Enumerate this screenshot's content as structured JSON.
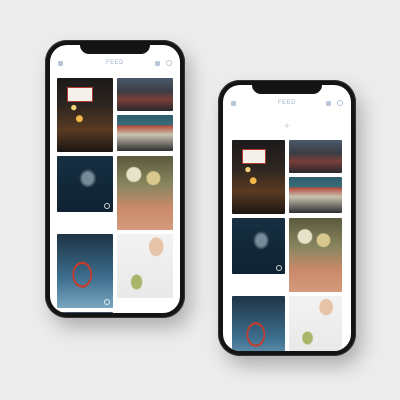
{
  "left_phone": {
    "header": {
      "title": "FEED",
      "left_icon": "camera-icon",
      "right_icons": [
        "notification-icon",
        "search-icon"
      ]
    },
    "photos": [
      {
        "name": "night-market-sign",
        "style": "night"
      },
      {
        "name": "street-scene",
        "style": "street"
      },
      {
        "name": "smoke-lamp",
        "style": "smoke"
      },
      {
        "name": "storefront",
        "style": "shop"
      },
      {
        "name": "basketball-hoop",
        "style": "hoop"
      },
      {
        "name": "incense-flowers",
        "style": "flowers"
      },
      {
        "name": "partial-photo-left",
        "style": "partial"
      },
      {
        "name": "hand-with-plant",
        "style": "hand"
      }
    ]
  },
  "right_phone": {
    "header": {
      "title": "FEED",
      "left_icon": "camera-icon",
      "right_icons": [
        "notification-icon",
        "search-icon"
      ]
    },
    "add_icon": "+",
    "photos": [
      {
        "name": "night-market-sign",
        "style": "night"
      },
      {
        "name": "street-scene",
        "style": "street"
      },
      {
        "name": "smoke-lamp",
        "style": "shop"
      },
      {
        "name": "storefront",
        "style": "shop"
      },
      {
        "name": "smoke",
        "style": "smoke"
      },
      {
        "name": "incense-flowers",
        "style": "flowers"
      },
      {
        "name": "basketball-hoop",
        "style": "hoop"
      },
      {
        "name": "hand-with-plant",
        "style": "hand"
      }
    ]
  }
}
